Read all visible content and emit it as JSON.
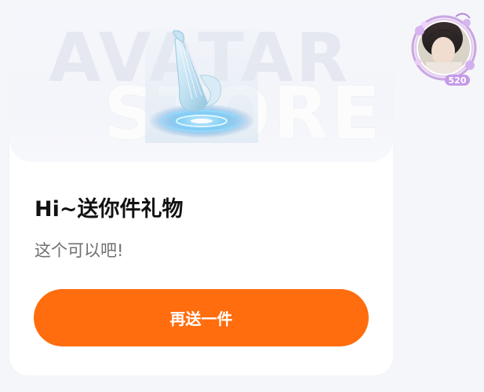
{
  "banner": {
    "watermark_line1": "AVATAR",
    "watermark_line2": "STORE",
    "gift_icon": "crystal-harp-icon"
  },
  "card": {
    "title": "Hi~送你件礼物",
    "message": "这个可以吧!",
    "button_label": "再送一件"
  },
  "avatar": {
    "frame_icon": "floral-avatar-frame",
    "badge": "520"
  },
  "colors": {
    "page_bg": "#f5f6f9",
    "card_bg": "#ffffff",
    "button_bg": "#ff6d0e",
    "title": "#111111",
    "message": "#6f6f6f"
  }
}
